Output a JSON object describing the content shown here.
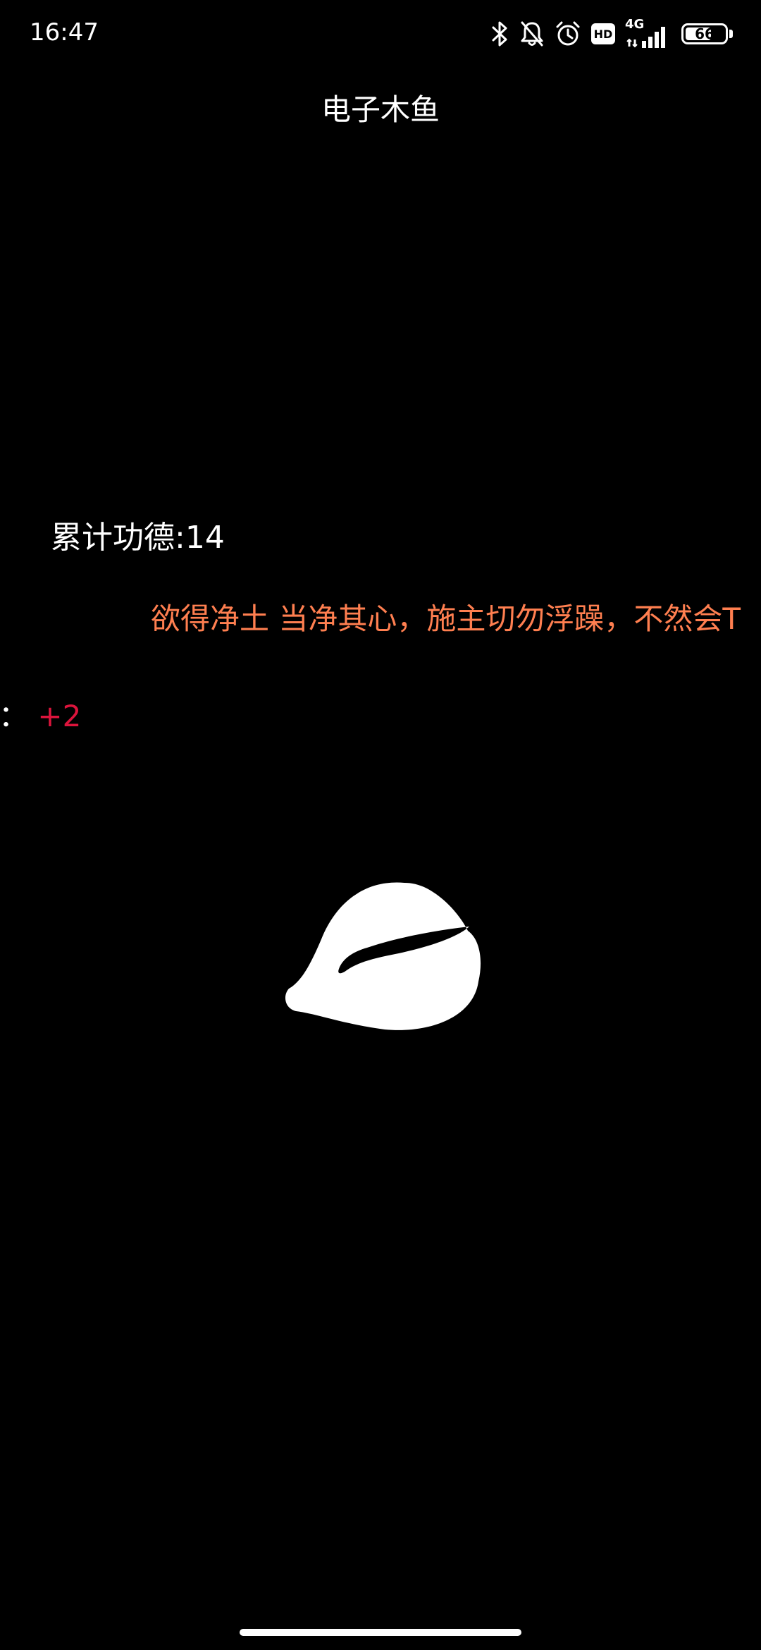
{
  "status_bar": {
    "time": "16:47",
    "icons": [
      "bluetooth-icon",
      "notifications-off-icon",
      "alarm-icon",
      "hd-icon",
      "signal-4g-icon",
      "battery-icon"
    ],
    "hd_label": "HD",
    "network_label": "4G",
    "battery_level": "66",
    "battery_fraction": 0.66
  },
  "app": {
    "title": "电子木鱼"
  },
  "merit": {
    "total_label": "累计功德:14",
    "gain_label": "德：",
    "gain_value": "+2",
    "gain_color": "#dc143c"
  },
  "quote": {
    "text": "欲得净土 当净其心，施主切勿浮躁，不然会T",
    "color": "#ff7f50"
  },
  "fish": {
    "icon": "wooden-fish-icon",
    "color": "#ffffff"
  }
}
